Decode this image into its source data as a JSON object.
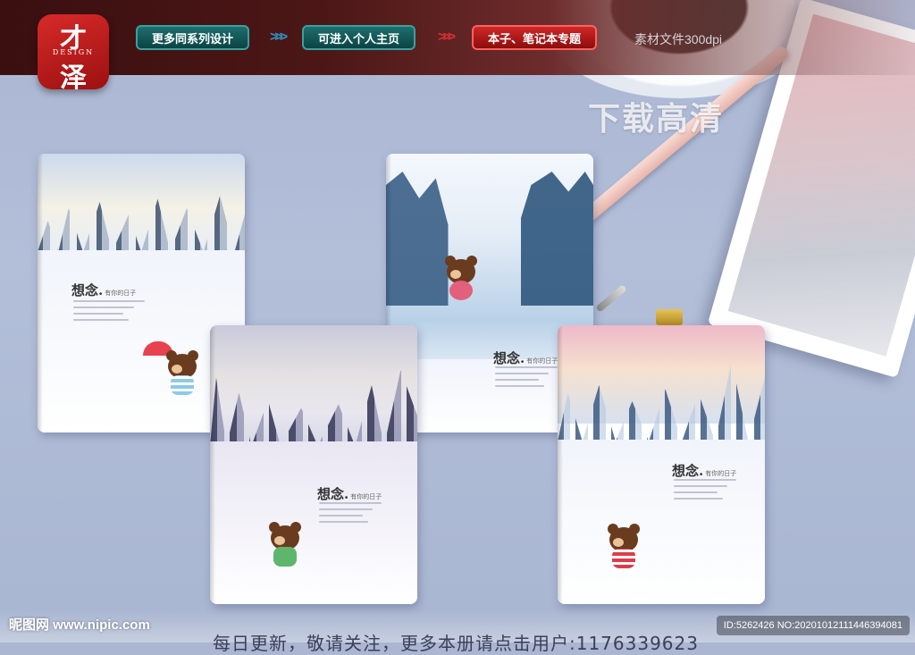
{
  "logo": {
    "char1": "才",
    "tag": "DESIGN",
    "char2": "泽"
  },
  "nav": {
    "more_designs": "更多同系列设计",
    "personal_home": "可进入个人主页",
    "notebook_topic": "本子、笔记本专题"
  },
  "resource_info": "素材文件300dpi",
  "download_hd": "下载高清",
  "notebooks": {
    "title": "想念.",
    "subtitle": "有你的日子"
  },
  "footer": {
    "watermark": "昵图网 www.nipic.com",
    "id": "ID:5262426 NO:20201012111446394081",
    "bottom_text": "每日更新，敬请关注，更多本册请点击用户:1176339623"
  },
  "colors": {
    "accent_teal": "#1e6e6e",
    "accent_red": "#d02828",
    "banner_dark": "#3a0f10"
  }
}
